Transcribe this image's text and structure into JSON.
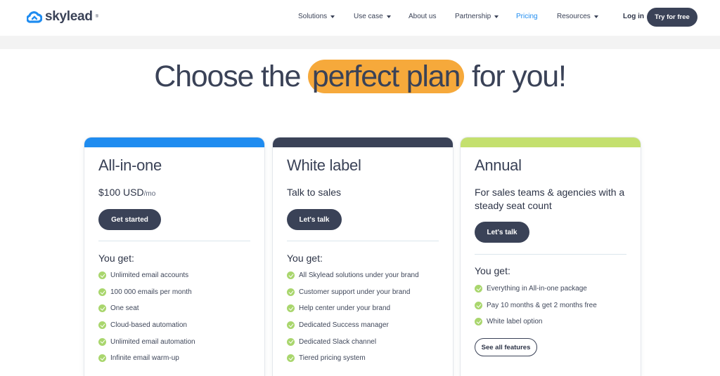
{
  "brand": {
    "name": "skylead",
    "mark": "®",
    "color": "#1f8cf0"
  },
  "nav": {
    "items": [
      {
        "label": "Solutions",
        "has_dropdown": true
      },
      {
        "label": "Use case",
        "has_dropdown": true
      },
      {
        "label": "About us",
        "has_dropdown": false
      },
      {
        "label": "Partnership",
        "has_dropdown": true
      },
      {
        "label": "Pricing",
        "has_dropdown": false,
        "active": true
      },
      {
        "label": "Resources",
        "has_dropdown": true
      }
    ],
    "login": "Log in",
    "cta": "Try for free"
  },
  "hero": {
    "before": "Choose the ",
    "highlight": "perfect plan",
    "after": " for you!",
    "highlight_color": "#f6a93b"
  },
  "plans": [
    {
      "title": "All-in-one",
      "price": "$100 USD",
      "price_unit": "/mo",
      "accent": "#1f8cf0",
      "button": "Get started",
      "you_get": "You get:",
      "features": [
        "Unlimited email accounts",
        "100 000 emails per month",
        "One seat",
        "Cloud-based automation",
        "Unlimited email automation",
        "Infinite email warm-up"
      ]
    },
    {
      "title": "White label",
      "subtitle": "Talk to sales",
      "accent": "#3a4257",
      "button": "Let's talk",
      "you_get": "You get:",
      "features": [
        "All Skylead solutions under your brand",
        "Customer support under your brand",
        "Help center under your brand",
        "Dedicated Success manager",
        "Dedicated Slack channel",
        "Tiered pricing system"
      ]
    },
    {
      "title": "Annual",
      "subtitle": "For sales teams & agencies with a steady seat count",
      "accent": "#c4e06e",
      "button": "Let's talk",
      "you_get": "You get:",
      "features": [
        "Everything in All-in-one package",
        "Pay 10 months & get 2 months free",
        "White label option"
      ],
      "secondary_button": "See all features"
    }
  ]
}
